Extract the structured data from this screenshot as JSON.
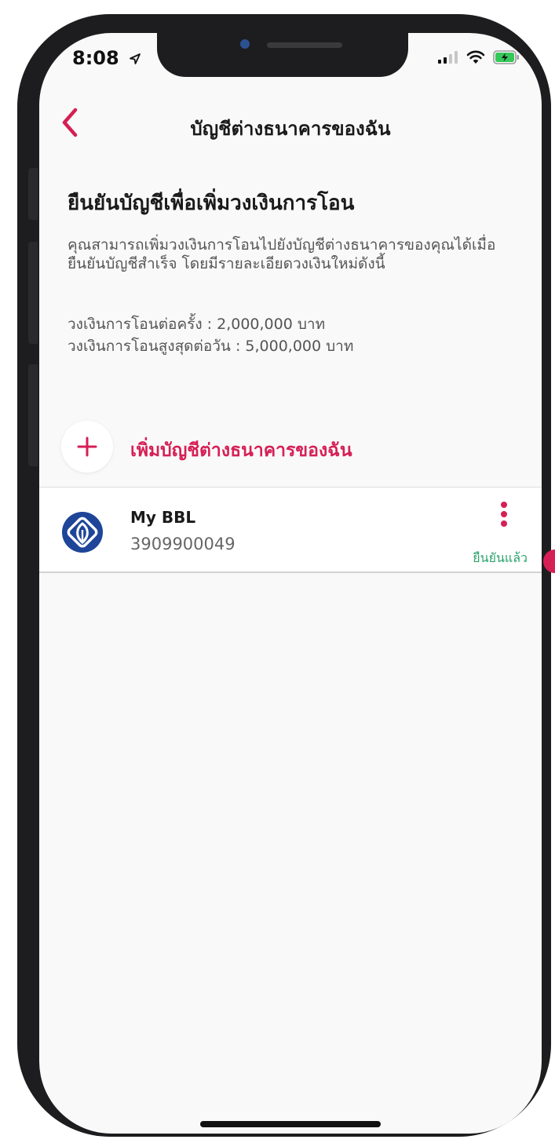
{
  "status_bar": {
    "time": "8:08",
    "location_icon": "location-arrow-icon",
    "signal_icon": "cellular-signal-icon",
    "wifi_icon": "wifi-icon",
    "battery_icon": "battery-charging-icon"
  },
  "header": {
    "title": "บัญชีต่างธนาคารของฉัน",
    "back_icon": "chevron-left-icon"
  },
  "intro": {
    "heading": "ยืนยันบัญชีเพื่อเพิ่มวงเงินการโอน",
    "description": "คุณสามารถเพิ่มวงเงินการโอนไปยังบัญชีต่างธนาคารของคุณได้เมื่อยืนยันบัญชีสำเร็จ โดยมีรายละเอียดวงเงินใหม่ดังนี้",
    "limit_per_transaction": "วงเงินการโอนต่อครั้ง : 2,000,000 บาท",
    "limit_per_day": "วงเงินการโอนสูงสุดต่อวัน : 5,000,000 บาท"
  },
  "add_account": {
    "label": "เพิ่มบัญชีต่างธนาคารของฉัน",
    "icon": "plus-icon"
  },
  "accounts": [
    {
      "name": "My BBL",
      "number": "3909900049",
      "status": "ยืนยันแล้ว",
      "logo_icon": "bangkok-bank-logo-icon",
      "menu_icon": "more-vertical-icon"
    }
  ],
  "colors": {
    "accent": "#d61f55",
    "verified": "#2aa36b",
    "bank_logo": "#1e4598"
  }
}
